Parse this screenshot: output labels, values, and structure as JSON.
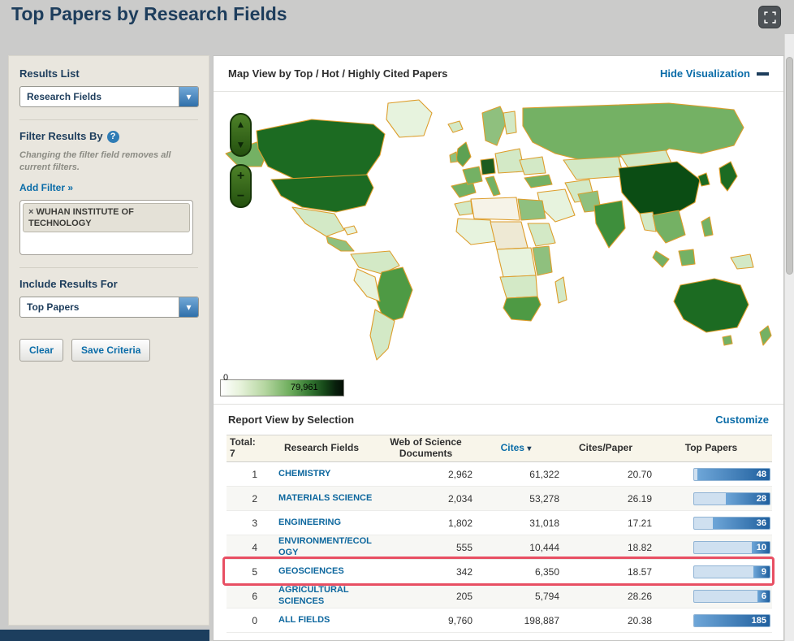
{
  "app": {
    "title": "Top Papers by Research Fields"
  },
  "icons": {
    "chevron_down": "▾",
    "help": "?",
    "close": "×",
    "sort_desc": "▾",
    "arrow_up": "▲",
    "arrow_down": "▼",
    "zoom_in": "+",
    "zoom_out": "−"
  },
  "sidebar": {
    "results_list_label": "Results List",
    "results_list_value": "Research Fields",
    "filter_label": "Filter Results By",
    "filter_note": "Changing the filter field removes all current filters.",
    "add_filter_label": "Add Filter »",
    "filter_tag": "WUHAN INSTITUTE OF TECHNOLOGY",
    "include_results_label": "Include Results For",
    "include_results_value": "Top Papers",
    "clear_label": "Clear",
    "save_label": "Save Criteria"
  },
  "visualization": {
    "title": "Map View by  Top / Hot / Highly Cited Papers",
    "hide_label": "Hide Visualization",
    "legend_min": "0",
    "legend_max": "79,961"
  },
  "report": {
    "title": "Report View by Selection",
    "customize_label": "Customize",
    "table": {
      "total_label": "Total:",
      "total_value": "7",
      "col_field": "Research Fields",
      "col_wos": "Web of Science Documents",
      "col_cites": "Cites",
      "col_cpp": "Cites/Paper",
      "col_top": "Top Papers",
      "rows": [
        {
          "rank": "1",
          "field": "CHEMISTRY",
          "wos": "2,962",
          "cites": "61,322",
          "cpp": "20.70",
          "top": "48",
          "bar_pct": 96
        },
        {
          "rank": "2",
          "field": "MATERIALS SCIENCE",
          "wos": "2,034",
          "cites": "53,278",
          "cpp": "26.19",
          "top": "28",
          "bar_pct": 58
        },
        {
          "rank": "3",
          "field": "ENGINEERING",
          "wos": "1,802",
          "cites": "31,018",
          "cpp": "17.21",
          "top": "36",
          "bar_pct": 75
        },
        {
          "rank": "4",
          "field": "ENVIRONMENT/ECOLOGY",
          "wos": "555",
          "cites": "10,444",
          "cpp": "18.82",
          "top": "10",
          "bar_pct": 24
        },
        {
          "rank": "5",
          "field": "GEOSCIENCES",
          "wos": "342",
          "cites": "6,350",
          "cpp": "18.57",
          "top": "9",
          "bar_pct": 22
        },
        {
          "rank": "6",
          "field": "AGRICULTURAL SCIENCES",
          "wos": "205",
          "cites": "5,794",
          "cpp": "28.26",
          "top": "6",
          "bar_pct": 16
        },
        {
          "rank": "0",
          "field": "ALL FIELDS",
          "wos": "9,760",
          "cites": "198,887",
          "cpp": "20.38",
          "top": "185",
          "bar_pct": 100
        }
      ]
    }
  },
  "colors": {
    "highlight_border": "#e84f63",
    "accent_blue": "#0a6ca8",
    "navy": "#1d3d5c",
    "map_max_green": "#0b4d14"
  }
}
